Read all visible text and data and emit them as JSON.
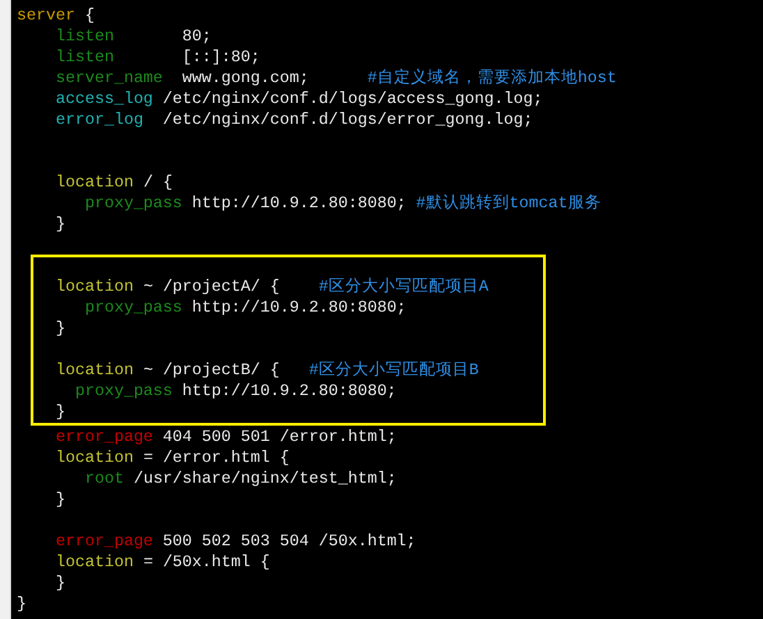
{
  "editor": {
    "lines": [
      {
        "kind": "code",
        "tokens": [
          {
            "kind": "block",
            "text": "server"
          },
          {
            "kind": "plain",
            "text": " {"
          }
        ]
      },
      {
        "kind": "code",
        "tokens": [
          {
            "kind": "directive",
            "text": "    listen"
          },
          {
            "kind": "plain",
            "text": "       80;"
          }
        ]
      },
      {
        "kind": "code",
        "tokens": [
          {
            "kind": "directive",
            "text": "    listen"
          },
          {
            "kind": "plain",
            "text": "       [::]:80;"
          }
        ]
      },
      {
        "kind": "code",
        "tokens": [
          {
            "kind": "directive",
            "text": "    server_name"
          },
          {
            "kind": "plain",
            "text": "  www.gong.com;"
          },
          {
            "kind": "comment",
            "text": "      #自定义域名，需要添加本地host"
          }
        ]
      },
      {
        "kind": "code",
        "tokens": [
          {
            "kind": "log",
            "text": "    access_log"
          },
          {
            "kind": "plain",
            "text": " /etc/nginx/conf.d/logs/access_gong.log;"
          }
        ]
      },
      {
        "kind": "code",
        "tokens": [
          {
            "kind": "log",
            "text": "    error_log"
          },
          {
            "kind": "plain",
            "text": "  /etc/nginx/conf.d/logs/error_gong.log;"
          }
        ]
      },
      {
        "kind": "blank"
      },
      {
        "kind": "blank"
      },
      {
        "kind": "code",
        "tokens": [
          {
            "kind": "location",
            "text": "    location"
          },
          {
            "kind": "plain",
            "text": " / {"
          }
        ]
      },
      {
        "kind": "code",
        "tokens": [
          {
            "kind": "directive",
            "text": "       proxy_pass"
          },
          {
            "kind": "plain",
            "text": " http://10.9.2.80:8080;"
          },
          {
            "kind": "comment",
            "text": " #默认跳转到tomcat服务"
          }
        ]
      },
      {
        "kind": "code",
        "tokens": [
          {
            "kind": "plain",
            "text": "    }"
          }
        ]
      },
      {
        "kind": "blank"
      },
      {
        "kind": "blank"
      },
      {
        "kind": "code",
        "tokens": [
          {
            "kind": "location",
            "text": "    location"
          },
          {
            "kind": "plain",
            "text": " ~ /projectA/ {"
          },
          {
            "kind": "comment",
            "text": "    #区分大小写匹配项目A"
          }
        ]
      },
      {
        "kind": "code",
        "tokens": [
          {
            "kind": "directive",
            "text": "       proxy_pass"
          },
          {
            "kind": "plain",
            "text": " http://10.9.2.80:8080;"
          }
        ]
      },
      {
        "kind": "code",
        "tokens": [
          {
            "kind": "plain",
            "text": "    }"
          }
        ]
      },
      {
        "kind": "blank"
      },
      {
        "kind": "code",
        "tokens": [
          {
            "kind": "location",
            "text": "    location"
          },
          {
            "kind": "plain",
            "text": " ~ /projectB/ {"
          },
          {
            "kind": "comment",
            "text": "   #区分大小写匹配项目B"
          }
        ]
      },
      {
        "kind": "code",
        "tokens": [
          {
            "kind": "directive",
            "text": "      proxy_pass"
          },
          {
            "kind": "plain",
            "text": " http://10.9.2.80:8080;"
          }
        ]
      },
      {
        "kind": "code",
        "tokens": [
          {
            "kind": "plain",
            "text": "    }"
          }
        ]
      },
      {
        "kind": "code",
        "tokens": [
          {
            "kind": "error",
            "text": "    error_page"
          },
          {
            "kind": "plain",
            "text": " 404 500 501 /error.html;"
          }
        ]
      },
      {
        "kind": "code",
        "tokens": [
          {
            "kind": "location",
            "text": "    location"
          },
          {
            "kind": "plain",
            "text": " = /error.html {"
          }
        ]
      },
      {
        "kind": "code",
        "tokens": [
          {
            "kind": "directive",
            "text": "       root"
          },
          {
            "kind": "plain",
            "text": " /usr/share/nginx/test_html;"
          }
        ]
      },
      {
        "kind": "code",
        "tokens": [
          {
            "kind": "plain",
            "text": "    }"
          }
        ]
      },
      {
        "kind": "blank"
      },
      {
        "kind": "code",
        "tokens": [
          {
            "kind": "error",
            "text": "    error_page"
          },
          {
            "kind": "plain",
            "text": " 500 502 503 504 /50x.html;"
          }
        ]
      },
      {
        "kind": "code",
        "tokens": [
          {
            "kind": "location",
            "text": "    location"
          },
          {
            "kind": "plain",
            "text": " = /50x.html {"
          }
        ]
      },
      {
        "kind": "code",
        "tokens": [
          {
            "kind": "plain",
            "text": "    }"
          }
        ]
      },
      {
        "kind": "code",
        "tokens": [
          {
            "kind": "plain",
            "text": "}"
          }
        ]
      }
    ]
  }
}
